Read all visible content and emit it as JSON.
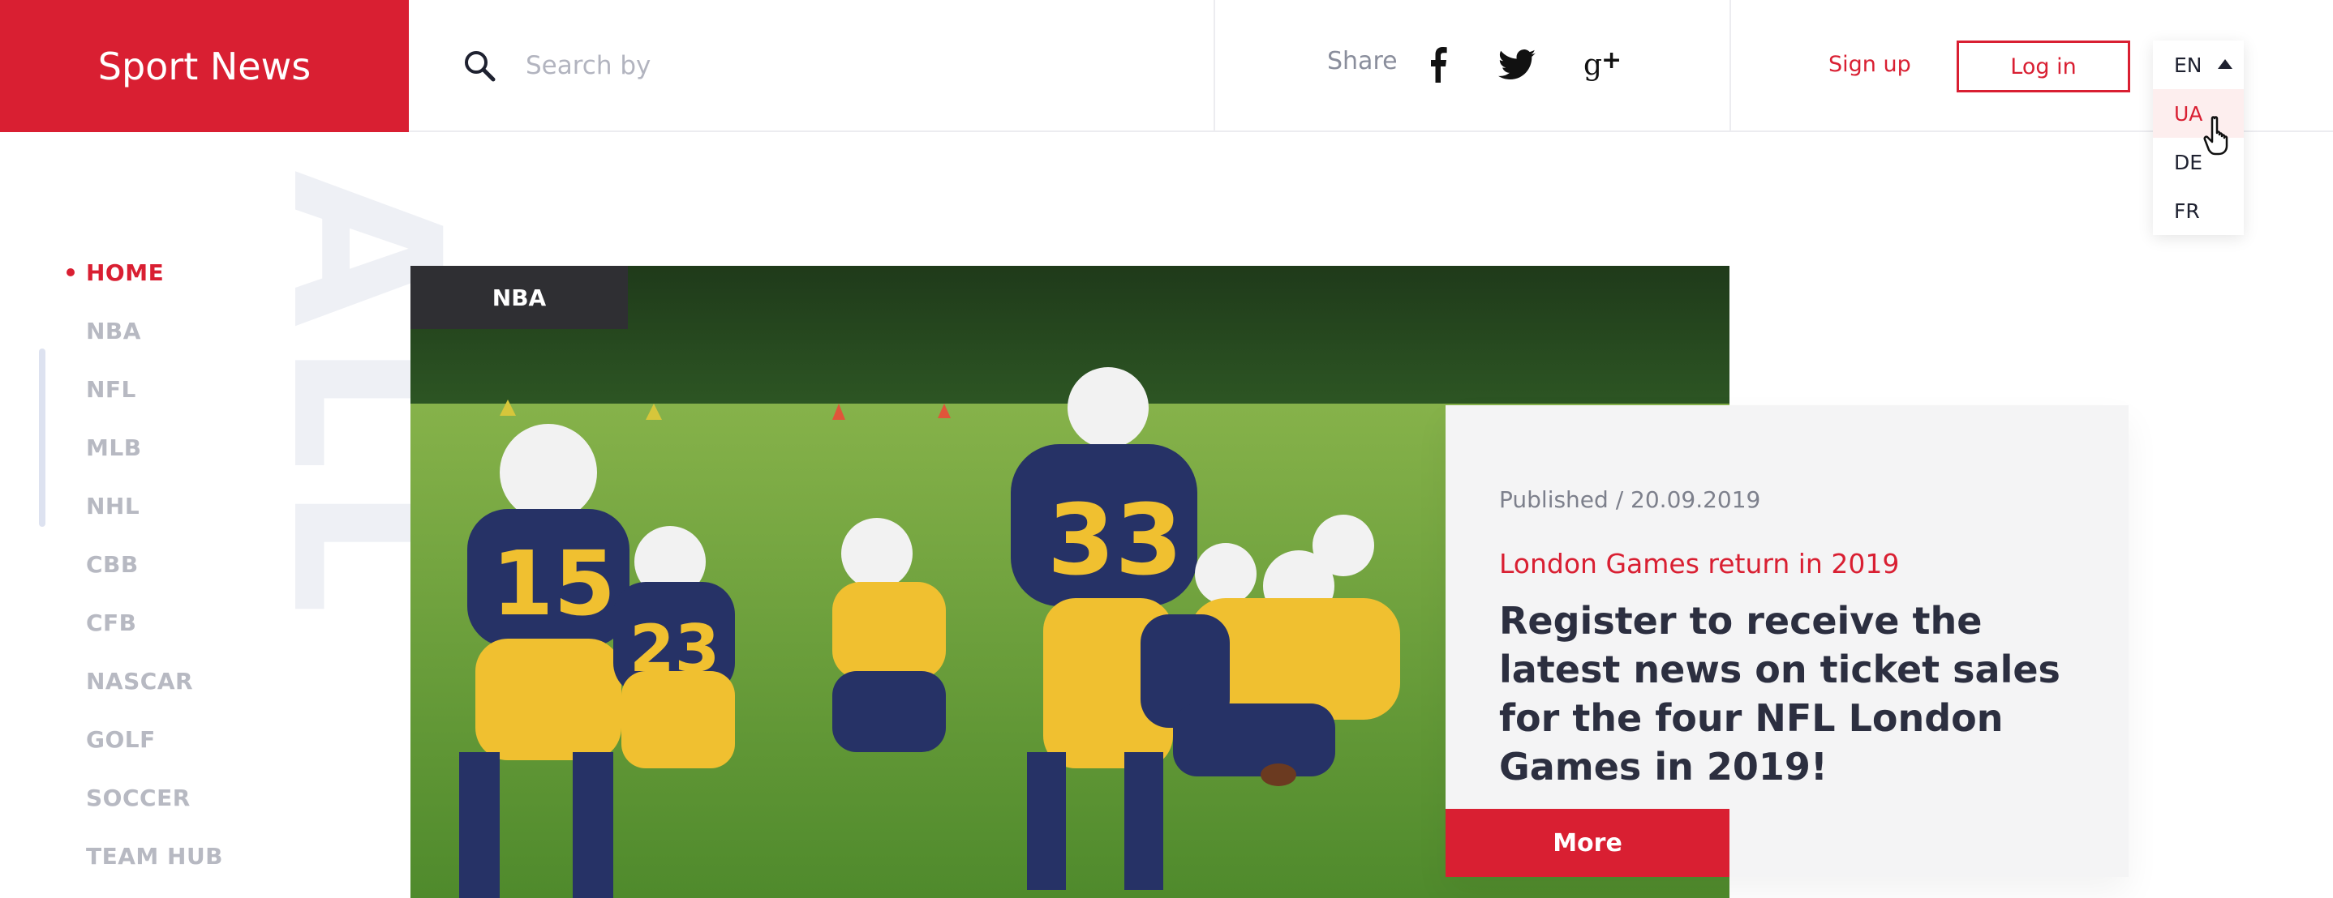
{
  "brand": {
    "logo": "Sport News",
    "accent": "#d91f32"
  },
  "search": {
    "placeholder": "Search by",
    "icon": "search-icon"
  },
  "share": {
    "label": "Share",
    "networks": [
      "facebook-icon",
      "twitter-icon",
      "google-plus-icon"
    ]
  },
  "auth": {
    "signup_label": "Sign up",
    "login_label": "Log in"
  },
  "language": {
    "current": "EN",
    "options": [
      "UA",
      "DE",
      "FR"
    ],
    "highlighted": "UA"
  },
  "sidebar": {
    "items": [
      {
        "label": "HOME",
        "active": true
      },
      {
        "label": "NBA"
      },
      {
        "label": "NFL"
      },
      {
        "label": "MLB"
      },
      {
        "label": "NHL"
      },
      {
        "label": "CBB"
      },
      {
        "label": "CFB"
      },
      {
        "label": "NASCAR"
      },
      {
        "label": "GOLF"
      },
      {
        "label": "SOCCER"
      },
      {
        "label": "TEAM HUB"
      }
    ],
    "watermark": "ALL"
  },
  "hero": {
    "tag": "NBA",
    "published": "Published / 20.09.2019",
    "subtitle": "London Games return in 2019",
    "headline": "Register to receive the latest news on ticket sales for the four NFL London Games in 2019!",
    "more_label": "More",
    "image": "youth-football-players-photo"
  }
}
